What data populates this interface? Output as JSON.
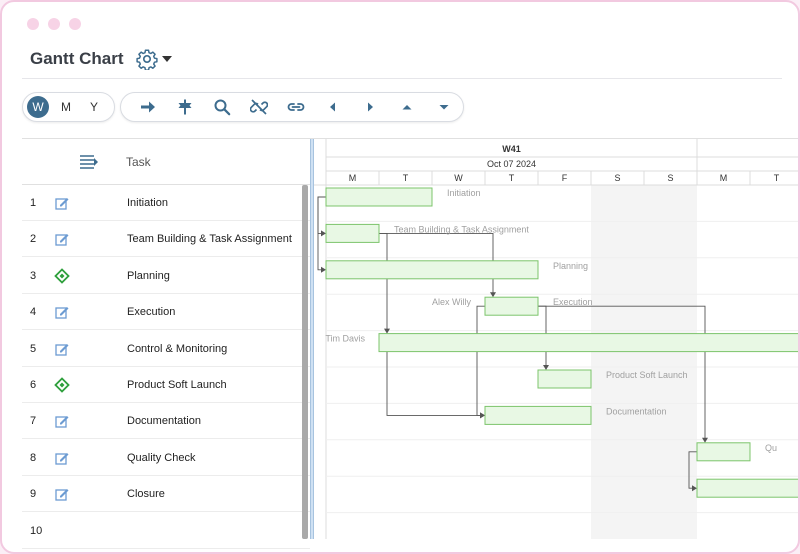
{
  "app": {
    "title": "Gantt Chart"
  },
  "icons": {
    "settings": "gear-icon",
    "dropdown": "caret-down-icon"
  },
  "view_scale": {
    "options": [
      "W",
      "M",
      "Y"
    ],
    "selected": "W"
  },
  "toolbar": {
    "tools": [
      {
        "name": "indent-icon"
      },
      {
        "name": "milestone-icon"
      },
      {
        "name": "search-icon"
      },
      {
        "name": "unlink-icon"
      },
      {
        "name": "link-icon"
      },
      {
        "name": "scroll-left-icon"
      },
      {
        "name": "scroll-right-icon"
      },
      {
        "name": "move-up-icon"
      },
      {
        "name": "move-down-icon"
      }
    ]
  },
  "grid": {
    "column_task": "Task",
    "rows": [
      {
        "num": "1",
        "type": "task",
        "name": "Initiation"
      },
      {
        "num": "2",
        "type": "task",
        "name": "Team Building & Task Assignment"
      },
      {
        "num": "3",
        "type": "milestone",
        "name": "Planning"
      },
      {
        "num": "4",
        "type": "task",
        "name": "Execution"
      },
      {
        "num": "5",
        "type": "task",
        "name": "Control & Monitoring"
      },
      {
        "num": "6",
        "type": "milestone",
        "name": "Product Soft Launch"
      },
      {
        "num": "7",
        "type": "task",
        "name": "Documentation"
      },
      {
        "num": "8",
        "type": "task",
        "name": "Quality Check"
      },
      {
        "num": "9",
        "type": "task",
        "name": "Closure"
      },
      {
        "num": "10",
        "type": "empty",
        "name": ""
      }
    ]
  },
  "timeline": {
    "week_label": "W41",
    "date_label": "Oct 07 2024",
    "days": [
      "M",
      "T",
      "W",
      "T",
      "F",
      "S",
      "S",
      "M",
      "T"
    ],
    "weekend_columns": [
      5,
      6
    ]
  },
  "gantt": {
    "bars": [
      {
        "row": 0,
        "start": 0,
        "length": 2,
        "label": "Initiation",
        "label_side": "right"
      },
      {
        "row": 1,
        "start": 0,
        "length": 1,
        "label": "Team Building & Task Assignment",
        "label_side": "right"
      },
      {
        "row": 2,
        "start": 0,
        "length": 4,
        "label": "Planning",
        "label_side": "right"
      },
      {
        "row": 3,
        "start": 3,
        "length": 1,
        "label": "Execution",
        "label_side": "right",
        "resource": "Alex Willy"
      },
      {
        "row": 4,
        "start": 1,
        "length": 8.5,
        "label": "",
        "label_side": "right",
        "resource": "Tim Davis"
      },
      {
        "row": 5,
        "start": 4,
        "length": 1,
        "label": "Product Soft Launch",
        "label_side": "right"
      },
      {
        "row": 6,
        "start": 3,
        "length": 2,
        "label": "Documentation",
        "label_side": "right"
      },
      {
        "row": 7,
        "start": 7,
        "length": 1,
        "label": "Qu",
        "label_side": "right"
      },
      {
        "row": 8,
        "start": 7,
        "length": 2,
        "label": "",
        "label_side": "right"
      }
    ],
    "links": [
      {
        "from": 0,
        "to": 1
      },
      {
        "from": 0,
        "to": 2
      },
      {
        "from": 1,
        "to": 3
      },
      {
        "from": 1,
        "to": 4
      },
      {
        "from": 3,
        "to": 5
      },
      {
        "from": 3,
        "to": 6
      },
      {
        "from": 3,
        "to": 7
      },
      {
        "from": 4,
        "to": 6
      },
      {
        "from": 7,
        "to": 8
      }
    ],
    "colors": {
      "bar_fill": "#e8f8e4",
      "bar_border": "#7cc46b",
      "label": "#a0a0a0",
      "link": "#555555",
      "weekend": "#f4f4f4",
      "milestone": "#2e9f3c"
    }
  }
}
